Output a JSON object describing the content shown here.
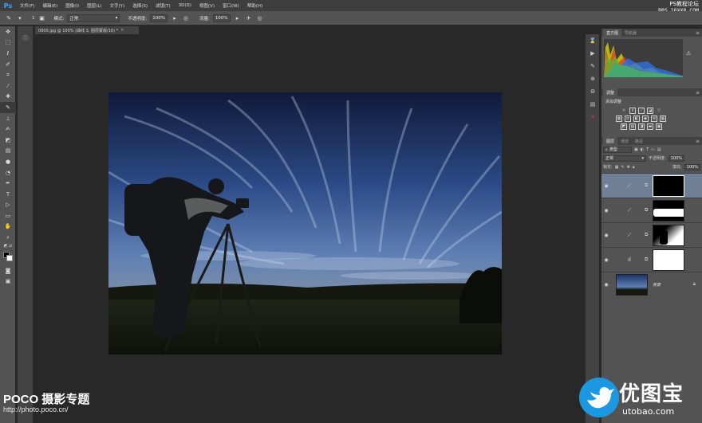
{
  "app": {
    "logo": "Ps",
    "menu": [
      "文件(F)",
      "编辑(E)",
      "图像(I)",
      "图层(L)",
      "文字(Y)",
      "选择(S)",
      "滤镜(T)",
      "3D(D)",
      "视图(V)",
      "窗口(W)",
      "帮助(H)"
    ],
    "watermark_top_line1": "PS教程论坛",
    "watermark_top_line2": "BBS.16XX8.COM"
  },
  "options_bar": {
    "brush_size": "1",
    "mode_label": "模式:",
    "mode_value": "正常",
    "opacity_label": "不透明度:",
    "opacity_value": "100%",
    "flow_label": "流量:",
    "flow_value": "100%"
  },
  "document": {
    "tab_title": "0900.jpg @ 100% (曲线 3, 图层蒙版/16) *",
    "tab_close": "×"
  },
  "tools": [
    "move-tool",
    "marquee-tool",
    "lasso-tool",
    "quick-select-tool",
    "crop-tool",
    "eyedropper-tool",
    "healing-tool",
    "brush-tool",
    "clone-stamp-tool",
    "history-brush-tool",
    "eraser-tool",
    "gradient-tool",
    "blur-tool",
    "dodge-tool",
    "pen-tool",
    "type-tool",
    "path-select-tool",
    "shape-tool",
    "hand-tool",
    "zoom-tool"
  ],
  "panels": {
    "histogram_tabs": [
      "直方图",
      "导航器"
    ],
    "histogram_warning": "⚠",
    "adjust_tab": "调整",
    "adjust_title": "添加调整",
    "layers_tabs": [
      "图层",
      "通道",
      "路径"
    ],
    "filter_kind": "类型",
    "blend_mode": "正常",
    "opacity_label": "不透明度:",
    "opacity_value": "100%",
    "lock_label": "锁定:",
    "fill_label": "填充:",
    "fill_value": "100%",
    "background_layer_name": "背景"
  },
  "watermarks": {
    "poco_title": "POCO 摄影专题",
    "poco_url": "http://photo.poco.cn/",
    "utobao_cn": "优图宝",
    "utobao_url": "utobao.com"
  },
  "colors": {
    "accent_ps": "#31a8ff",
    "panel_bg": "#535353",
    "selected_layer": "#6e7f96",
    "utobao_blue": "#1c98e0"
  }
}
